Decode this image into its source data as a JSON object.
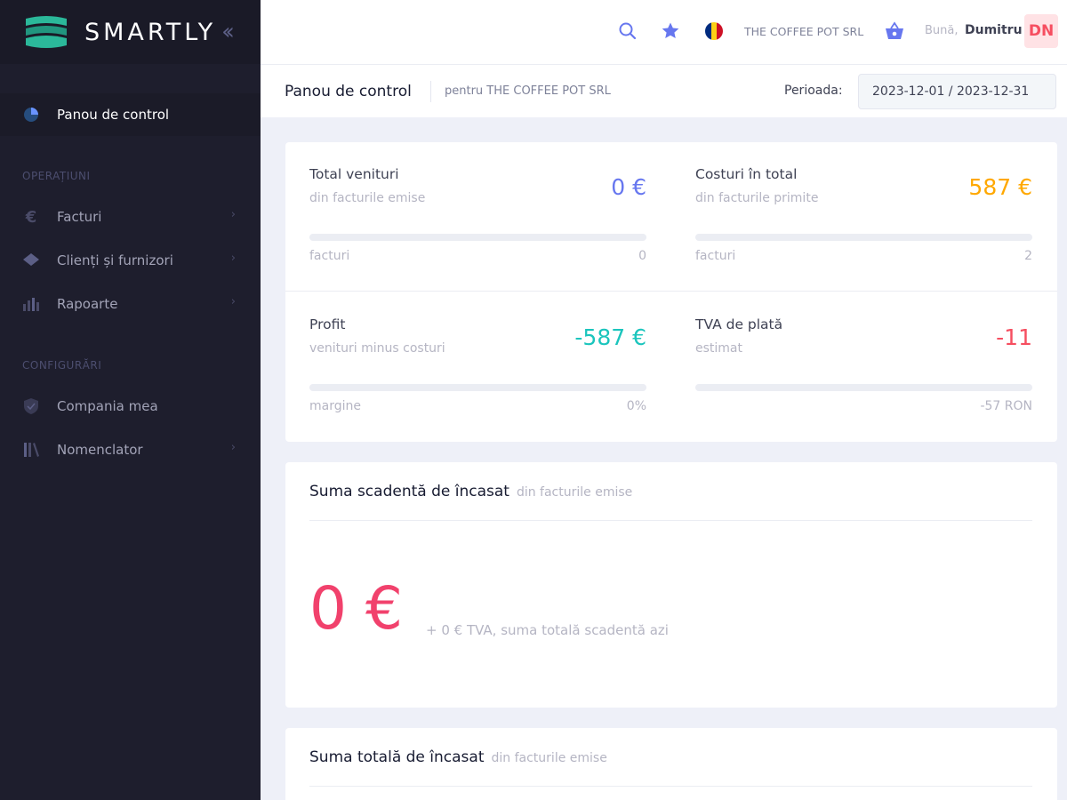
{
  "brand": {
    "name": "SMARTLY"
  },
  "sidebar": {
    "active": {
      "label": "Panou de control",
      "icon": "pie-chart-icon"
    },
    "sections": [
      {
        "title": "OPERAȚIUNI"
      },
      {
        "title": "CONFIGURĂRI"
      }
    ],
    "items": [
      {
        "label": "Facturi",
        "icon": "euro-icon",
        "has_arrow": true
      },
      {
        "label": "Clienți și furnizori",
        "icon": "layers-icon",
        "has_arrow": true
      },
      {
        "label": "Rapoarte",
        "icon": "bar-chart-icon",
        "has_arrow": true
      },
      {
        "label": "Compania mea",
        "icon": "shield-icon",
        "has_arrow": false
      },
      {
        "label": "Nomenclator",
        "icon": "library-icon",
        "has_arrow": true
      }
    ]
  },
  "header": {
    "company": "THE COFFEE POT SRL",
    "greeting": "Bună,",
    "user": "Dumitru",
    "avatar": "DN",
    "flag_colors": [
      "#002B7F",
      "#FCD116",
      "#CE1126"
    ]
  },
  "subheader": {
    "title": "Panou de control",
    "subtitle": "pentru THE COFFEE POT SRL",
    "period_label": "Perioada:",
    "period_value": "2023-12-01 / 2023-12-31"
  },
  "stats": [
    {
      "title": "Total venituri",
      "subtitle": "din facturile emise",
      "value": "0 €",
      "color": "#6777ef",
      "foot_label": "facturi",
      "foot_value": "0",
      "progress": 0
    },
    {
      "title": "Costuri în total",
      "subtitle": "din facturile primite",
      "value": "587 €",
      "color": "#ffa800",
      "foot_label": "facturi",
      "foot_value": "2",
      "progress": 0
    },
    {
      "title": "Profit",
      "subtitle": "venituri minus costuri",
      "value": "-587 €",
      "color": "#1bc5bd",
      "foot_label": "margine",
      "foot_value": "0%",
      "progress": 0
    },
    {
      "title": "TVA de plată",
      "subtitle": "estimat",
      "value": "-11",
      "color": "#f64e60",
      "foot_label": "",
      "foot_value": "-57 RON",
      "progress": 0
    }
  ],
  "due": {
    "title": "Suma scadentă de încasat",
    "subtitle": "din facturile emise",
    "amount": "0 €",
    "note": "+ 0 € TVA, suma totală scadentă azi"
  },
  "total": {
    "title": "Suma totală de încasat",
    "subtitle": "din facturile emise"
  }
}
